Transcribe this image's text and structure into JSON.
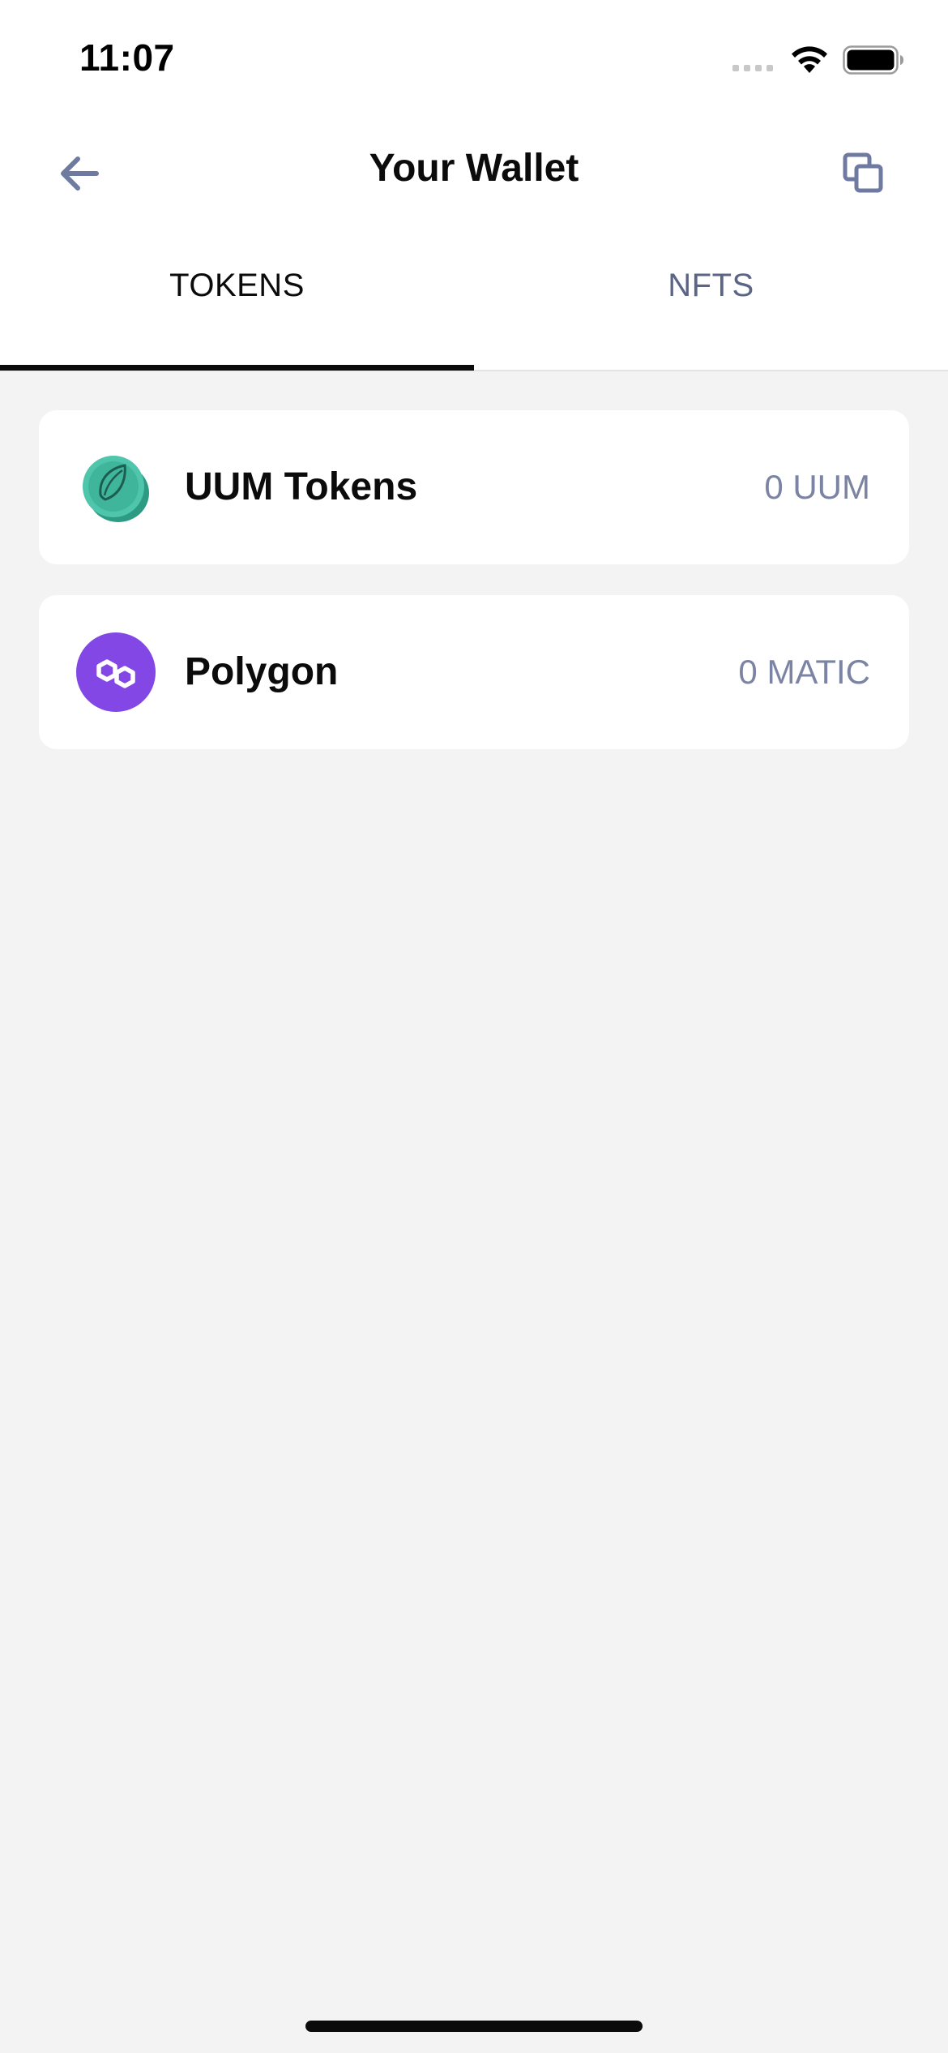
{
  "status_bar": {
    "time": "11:07",
    "icons": [
      "signal-icon",
      "wifi-icon",
      "battery-icon"
    ]
  },
  "header": {
    "title": "Your Wallet",
    "back_icon": "arrow-left-icon",
    "copy_icon": "copy-icon"
  },
  "tabs": [
    {
      "label": "TOKENS",
      "active": true
    },
    {
      "label": "NFTS",
      "active": false
    }
  ],
  "tokens": [
    {
      "name": "UUM Tokens",
      "balance": "0 UUM",
      "icon": "uum-coin-icon"
    },
    {
      "name": "Polygon",
      "balance": "0 MATIC",
      "icon": "polygon-icon"
    }
  ],
  "colors": {
    "text_primary": "#0b0b0b",
    "text_muted": "#7c84a3",
    "icon_accent": "#6f7aa0",
    "polygon_purple": "#8247e5",
    "uum_teal": "#3fb59c",
    "background": "#f3f3f3"
  }
}
